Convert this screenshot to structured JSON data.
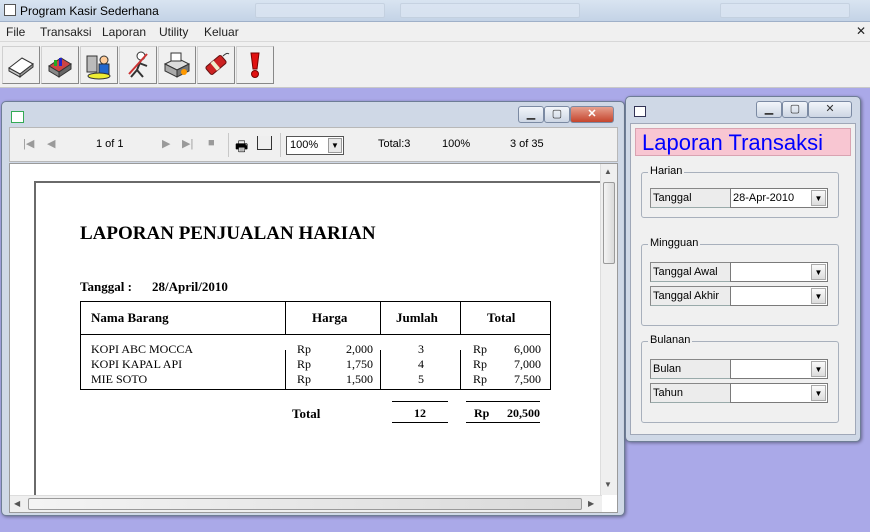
{
  "app": {
    "title": "Program Kasir Sederhana",
    "menu": [
      "File",
      "Transaksi",
      "Laporan",
      "Utility",
      "Keluar"
    ]
  },
  "toolbar": {
    "buttons": [
      "eraser-icon",
      "calculator-chart-icon",
      "users-computer-icon",
      "person-pen-icon",
      "fax-printer-icon",
      "dynamite-icon",
      "exclamation-icon"
    ]
  },
  "report_window": {
    "nav": {
      "page_indicator": "1 of 1",
      "zoom": "100%",
      "total": "Total:3",
      "percent": "100%",
      "progress": "3 of 35"
    },
    "report": {
      "title": "LAPORAN PENJUALAN HARIAN",
      "date_label": "Tanggal :",
      "date_value": "28/April/2010",
      "headers": [
        "Nama Barang",
        "Harga",
        "Jumlah",
        "Total"
      ],
      "rows": [
        {
          "name": "KOPI ABC MOCCA",
          "cur": "Rp",
          "price": "2,000",
          "qty": "3",
          "cur2": "Rp",
          "total": "6,000"
        },
        {
          "name": "KOPI KAPAL API",
          "cur": "Rp",
          "price": "1,750",
          "qty": "4",
          "cur2": "Rp",
          "total": "7,000"
        },
        {
          "name": "MIE SOTO",
          "cur": "Rp",
          "price": "1,500",
          "qty": "5",
          "cur2": "Rp",
          "total": "7,500"
        }
      ],
      "footer": {
        "label": "Total",
        "qty": "12",
        "cur": "Rp",
        "total": "20,500"
      }
    }
  },
  "filter_window": {
    "heading": "Laporan Transaksi",
    "heading_color": "#0000ff",
    "heading_bg": "#f8c6d2",
    "groups": {
      "harian": {
        "label": "Harian",
        "field": "Tanggal",
        "value": "28-Apr-2010"
      },
      "mingguan": {
        "label": "Mingguan",
        "field1": "Tanggal Awal",
        "value1": "",
        "field2": "Tanggal Akhir",
        "value2": ""
      },
      "bulanan": {
        "label": "Bulanan",
        "field1": "Bulan",
        "value1": "",
        "field2": "Tahun",
        "value2": ""
      }
    }
  }
}
